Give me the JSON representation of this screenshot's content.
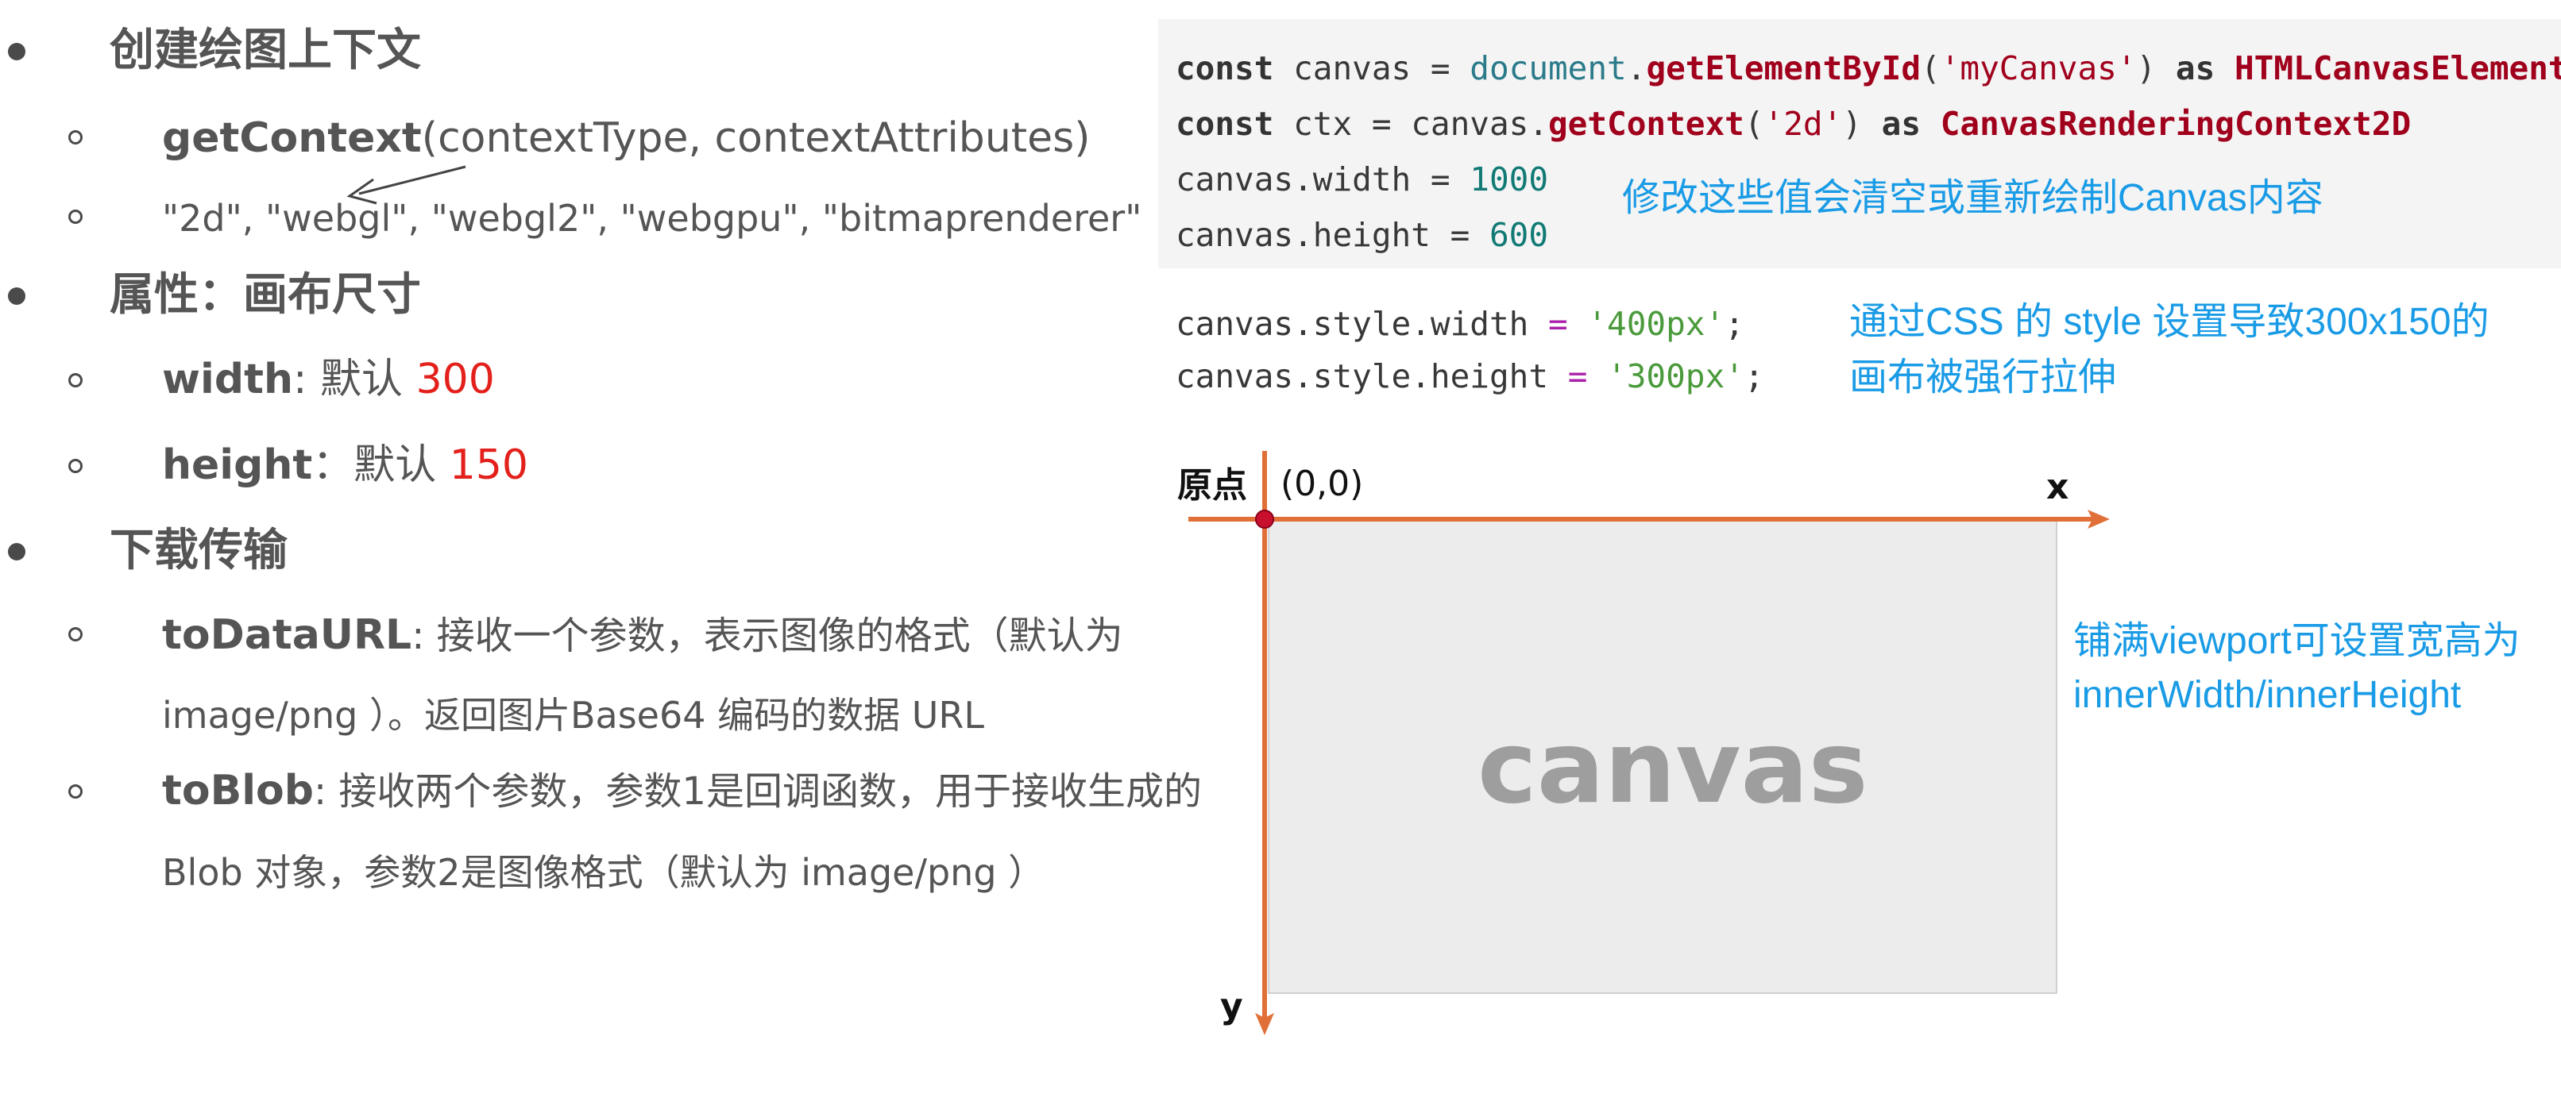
{
  "left": {
    "section_context": {
      "title": "创建绘图上下文",
      "method_name": "getContext",
      "method_args": "(contextType, contextAttributes)",
      "context_types": "\"2d\", \"webgl\", \"webgl2\", \"webgpu\", \"bitmaprenderer\""
    },
    "section_attrs": {
      "title": "属性：画布尺寸",
      "width_key": "width",
      "width_label": ": 默认 ",
      "width_default": "300",
      "height_key": "height",
      "height_label": "：默认 ",
      "height_default": "150"
    },
    "section_download": {
      "title": "下载传输",
      "todataurl_key": "toDataURL",
      "todataurl_line1": ": 接收一个参数，表示图像的格式（默认为",
      "todataurl_line2": "image/png ）。返回图片Base64 编码的数据 URL",
      "toblob_key": "toBlob",
      "toblob_line1": ": 接收两个参数，参数1是回调函数，用于接收生成的",
      "toblob_line2": "Blob 对象，参数2是图像格式（默认为 image/png ）"
    }
  },
  "code": {
    "line1": {
      "kw": "const",
      "var": " canvas = ",
      "obj": "document",
      "dot": ".",
      "fn": "getElementById",
      "open": "(",
      "str": "'myCanvas'",
      "close": ") ",
      "as": "as",
      "space": " ",
      "type": "HTMLCanvasElement"
    },
    "line2": {
      "kw": "const",
      "var": " ctx = canvas.",
      "fn": "getContext",
      "open": "(",
      "str": "'2d'",
      "close": ") ",
      "as": "as",
      "space": " ",
      "type": "CanvasRenderingContext2D"
    },
    "line3": {
      "lhs": "canvas.width = ",
      "num": "1000"
    },
    "line4": {
      "lhs": "canvas.height = ",
      "num": "600"
    },
    "line5": {
      "lhs": "canvas.style.width ",
      "eq": "=",
      "str": " '400px'",
      "semi": ";"
    },
    "line6": {
      "lhs": "canvas.style.height ",
      "eq": "=",
      "str": " '300px'",
      "semi": ";"
    },
    "note_reset": "修改这些值会清空或重新绘制Canvas内容",
    "note_css_1": "通过CSS 的 style 设置导致300x150的",
    "note_css_2": "画布被强行拉伸"
  },
  "diagram": {
    "origin_label": "原点",
    "origin_coords": "(0,0)",
    "x_label": "x",
    "y_label": "y",
    "canvas_word": "canvas",
    "note_viewport_1": "铺满viewport可设置宽高为",
    "note_viewport_2": "innerWidth/innerHeight",
    "colors": {
      "axis": "#e07038",
      "origin_dot": "#c8102e",
      "note": "#1a9be6",
      "highlight_red": "#e3201b"
    }
  }
}
